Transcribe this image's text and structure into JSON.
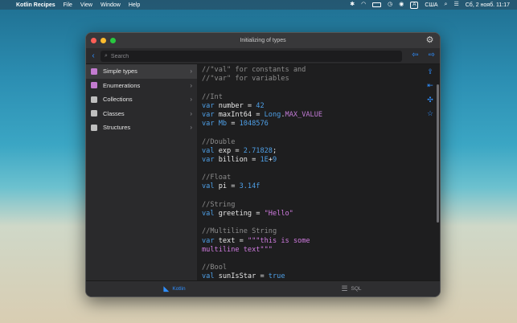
{
  "menubar": {
    "app_name": "Kotlin Recipes",
    "menus": [
      "File",
      "View",
      "Window",
      "Help"
    ],
    "input_source": "A",
    "language": "США",
    "clock": "Сб, 2 нояб. 11:17"
  },
  "window": {
    "title": "Initializing of types",
    "search_placeholder": "Search"
  },
  "sidebar": {
    "items": [
      {
        "label": "Simple types",
        "icon": "pink"
      },
      {
        "label": "Enumerations",
        "icon": "pink"
      },
      {
        "label": "Collections",
        "icon": "white"
      },
      {
        "label": "Classes",
        "icon": "white"
      },
      {
        "label": "Structures",
        "icon": "white"
      }
    ]
  },
  "code_lines": [
    [
      [
        "cm",
        "//\"val\" for constants and"
      ]
    ],
    [
      [
        "cm",
        "//\"var\" for variables"
      ]
    ],
    [],
    [
      [
        "cm",
        "//Int"
      ]
    ],
    [
      [
        "kw",
        "var"
      ],
      [
        "id",
        " number = "
      ],
      [
        "num",
        "42"
      ]
    ],
    [
      [
        "kw",
        "var"
      ],
      [
        "id",
        " maxInt64 = "
      ],
      [
        "type",
        "Long"
      ],
      [
        "id",
        "."
      ],
      [
        "const",
        "MAX_VALUE"
      ]
    ],
    [
      [
        "kw",
        "var"
      ],
      [
        "type",
        " Mb"
      ],
      [
        "id",
        " = "
      ],
      [
        "num",
        "1048576"
      ]
    ],
    [],
    [
      [
        "cm",
        "//Double"
      ]
    ],
    [
      [
        "kw",
        "val"
      ],
      [
        "id",
        " exp = "
      ],
      [
        "num",
        "2.71828"
      ],
      [
        "id",
        ";"
      ]
    ],
    [
      [
        "kw",
        "var"
      ],
      [
        "id",
        " billion = "
      ],
      [
        "num",
        "1E"
      ],
      [
        "id",
        "+"
      ],
      [
        "num",
        "9"
      ]
    ],
    [],
    [
      [
        "cm",
        "//Float"
      ]
    ],
    [
      [
        "kw",
        "val"
      ],
      [
        "id",
        " pi = "
      ],
      [
        "num",
        "3.14f"
      ]
    ],
    [],
    [
      [
        "cm",
        "//String"
      ]
    ],
    [
      [
        "kw",
        "val"
      ],
      [
        "id",
        " greeting = "
      ],
      [
        "str",
        "\"Hello\""
      ]
    ],
    [],
    [
      [
        "cm",
        "//Multiline String"
      ]
    ],
    [
      [
        "kw",
        "var"
      ],
      [
        "id",
        " text = "
      ],
      [
        "str",
        "\"\"\"this is some"
      ]
    ],
    [
      [
        "str",
        "multiline text\"\"\""
      ]
    ],
    [],
    [
      [
        "cm",
        "//Bool"
      ]
    ],
    [
      [
        "kw",
        "val"
      ],
      [
        "id",
        " sunIsStar = "
      ],
      [
        "kw",
        "true"
      ]
    ]
  ],
  "tabbar": {
    "tabs": [
      {
        "label": "Kotlin",
        "active": true,
        "icon": "kotlin-icon"
      },
      {
        "label": "SQL",
        "active": false,
        "icon": "database-icon"
      }
    ]
  },
  "colors": {
    "accent": "#2f8fff",
    "keyword": "#4e9fe6",
    "string": "#d07be0",
    "comment": "#8c8c8c"
  }
}
